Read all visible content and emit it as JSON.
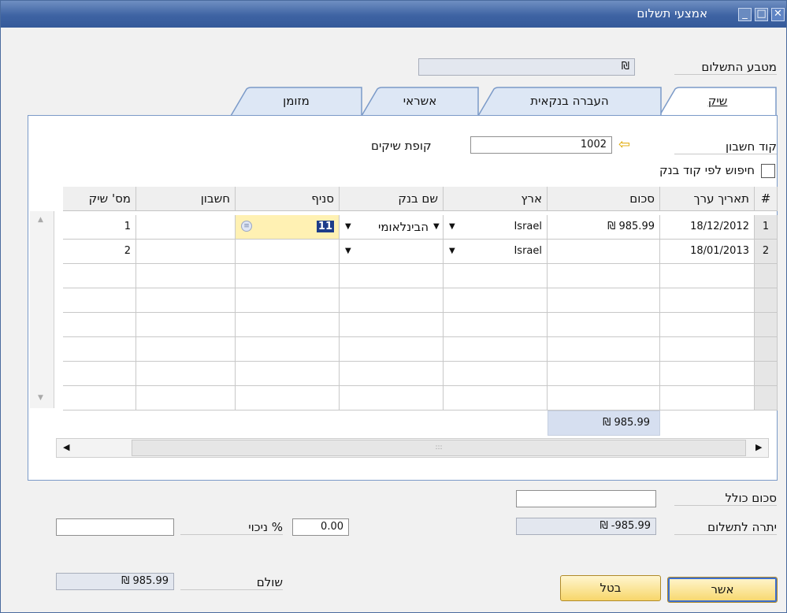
{
  "window": {
    "title": "אמצעי תשלום"
  },
  "currency": {
    "label": "מטבע התשלום",
    "value": "₪"
  },
  "tabs": [
    {
      "label": "שיק",
      "underline": "ש"
    },
    {
      "label": "העברה בנקאית",
      "underline": "ה"
    },
    {
      "label": "אשראי",
      "underline": "א"
    },
    {
      "label": "מזומן",
      "underline": "ז"
    }
  ],
  "account_code": {
    "label": "קוד חשבון",
    "value": "1002",
    "desc": "קופת שיקים"
  },
  "bank_search": {
    "label": "חיפוש לפי קוד בנק",
    "checked": false
  },
  "table": {
    "headers": [
      "#",
      "תאריך ערך",
      "סכום",
      "ארץ",
      "שם בנק",
      "סניף",
      "חשבון",
      "מס' שיק"
    ],
    "rows": [
      {
        "num": "1",
        "date": "18/12/2012",
        "amount": "₪ 985.99",
        "country": "Israel",
        "bank": "הבינלאומי",
        "branch": "11",
        "account": "",
        "check_no": "1"
      },
      {
        "num": "2",
        "date": "18/01/2013",
        "amount": "",
        "country": "Israel",
        "bank": "",
        "branch": "",
        "account": "",
        "check_no": "2"
      }
    ],
    "total": "₪ 985.99"
  },
  "total_amount": {
    "label": "סכום כולל",
    "value": ""
  },
  "balance_due": {
    "label": "יתרה לתשלום",
    "value": "₪ -985.99"
  },
  "discount": {
    "label": "% ניכוי",
    "value": "0.00",
    "amount": ""
  },
  "paid": {
    "label": "שולם",
    "value": "₪ 985.99"
  },
  "buttons": {
    "ok": "אשר",
    "cancel": "בטל"
  }
}
